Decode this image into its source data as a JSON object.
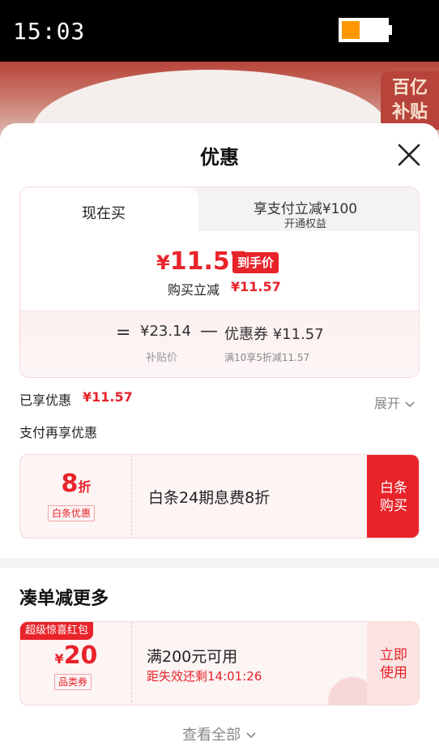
{
  "status_bar": {
    "time": "15:03"
  },
  "background": {
    "badge_text_line1": "百亿",
    "badge_text_line2": "补贴"
  },
  "sheet": {
    "title": "优惠"
  },
  "price_tabs": {
    "current_tab": "现在买",
    "other_tab_title": "享支付立减¥100",
    "other_tab_sub": "开通权益"
  },
  "price": {
    "yen": "¥",
    "final_amount": "11.57",
    "final_tag": "到手价",
    "buy_reduce_label": "购买立减",
    "buy_reduce_value": "¥11.57"
  },
  "calc": {
    "equals": "=",
    "subsidy_price": "¥23.14",
    "subsidy_label": "补贴价",
    "minus": "—",
    "coupon": "优惠券 ¥11.57",
    "coupon_rule": "满10享5折减11.57"
  },
  "enjoyed": {
    "label": "已享优惠",
    "value": "¥11.57",
    "expand": "展开"
  },
  "pay_more": {
    "label": "支付再享优惠"
  },
  "baitiao": {
    "discount": "8",
    "discount_unit": "折",
    "tag": "白条优惠",
    "text": "白条24期息费8折",
    "button_line1": "白条",
    "button_line2": "购买"
  },
  "more_deals": {
    "title": "凑单减更多",
    "ribbon": "超级惊喜红包",
    "yen": "¥",
    "amount": "20",
    "type": "品类券",
    "condition": "满200元可用",
    "expiry": "距失效还剩14:01:26",
    "button_line1": "立即",
    "button_line2": "使用"
  },
  "view_all": {
    "label": "查看全部"
  },
  "colors": {
    "accent": "#e8232a",
    "battery": "#ff9800"
  }
}
